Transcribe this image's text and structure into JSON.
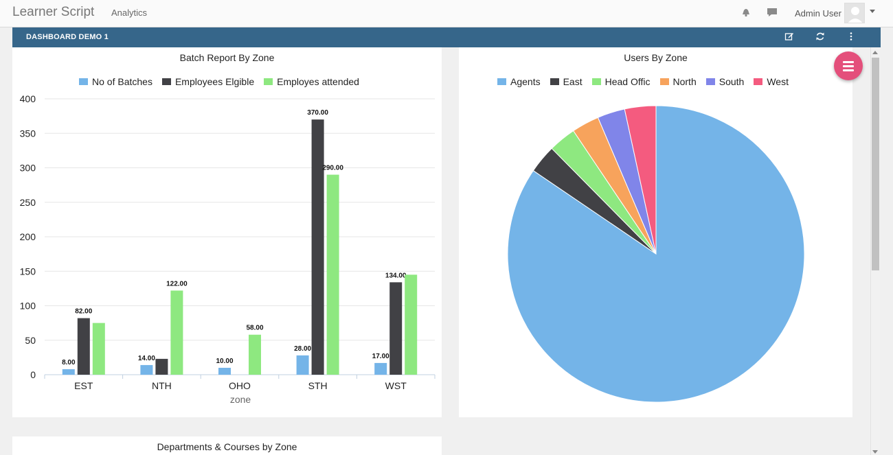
{
  "navbar": {
    "brand": "Learner Script",
    "links": [
      "Analytics"
    ],
    "user_name": "Admin User",
    "icons": [
      "bell-icon",
      "chat-icon",
      "user-avatar-icon",
      "caret-down-icon"
    ]
  },
  "dashboard": {
    "title": "DASHBOARD DEMO 1",
    "tools": [
      "edit-icon",
      "refresh-icon",
      "more-vertical-icon"
    ]
  },
  "panels": {
    "batch_report": {
      "title": "Batch Report By Zone"
    },
    "users_by_zone": {
      "title": "Users By Zone"
    },
    "departments_courses": {
      "title": "Departments & Courses by Zone"
    }
  },
  "colors": {
    "accent": "#36668a",
    "fab": "#e44f7b"
  },
  "chart_data": [
    {
      "type": "bar",
      "title": "Batch Report By Zone",
      "xlabel": "zone",
      "ylabel": "",
      "categories": [
        "EST",
        "NTH",
        "OHO",
        "STH",
        "WST"
      ],
      "series": [
        {
          "name": "No of Batches",
          "color": "#74b4e8",
          "values": [
            8,
            14,
            10,
            28,
            17
          ],
          "labels": [
            "8.00",
            "14.00",
            "10.00",
            "28.00",
            "17.00"
          ]
        },
        {
          "name": "Employees Elgible",
          "color": "#414145",
          "values": [
            82,
            23,
            0,
            370,
            134
          ],
          "labels": [
            "82.00",
            "",
            "",
            "370.00",
            "134.00"
          ]
        },
        {
          "name": "Employes attended",
          "color": "#8ee880",
          "values": [
            75,
            122,
            58,
            290,
            145
          ],
          "labels": [
            "",
            "122.00",
            "58.00",
            "290.00",
            ""
          ]
        }
      ],
      "yticks": [
        0,
        50,
        100,
        150,
        200,
        250,
        300,
        350,
        400
      ],
      "ylim": [
        0,
        400
      ],
      "grid": true,
      "legend": "top"
    },
    {
      "type": "pie",
      "title": "Users By Zone",
      "categories": [
        "Agents",
        "East",
        "Head Offic",
        "North",
        "South",
        "West"
      ],
      "values": [
        84.5,
        3.1,
        3.0,
        3.0,
        3.0,
        3.4
      ],
      "colors": [
        "#74b4e8",
        "#414145",
        "#8ee880",
        "#f7a35c",
        "#8085e9",
        "#f45b7f"
      ],
      "legend": "top"
    }
  ]
}
